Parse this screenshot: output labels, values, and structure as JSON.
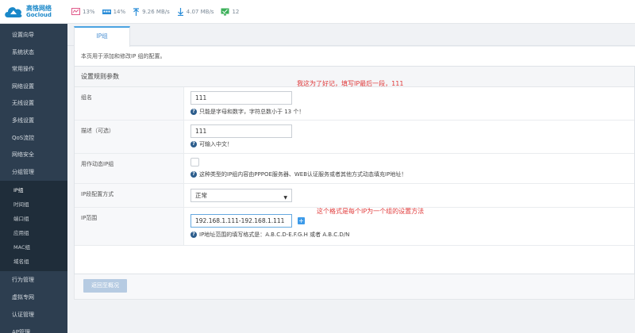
{
  "brand": {
    "name_cn": "高恪网络",
    "name_en": "Gocloud"
  },
  "status": {
    "cpu": "13%",
    "mem": "14%",
    "upload": "9.26 MB/s",
    "download": "4.07 MB/s",
    "connections": "12"
  },
  "menu_top": [
    "设置向导",
    "系统状态",
    "常用操作",
    "网络设置",
    "无线设置",
    "多线设置",
    "QoS流控",
    "网络安全",
    "分组管理"
  ],
  "submenu": [
    "IP组",
    "时间组",
    "端口组",
    "应用组",
    "MAC组",
    "域名组"
  ],
  "menu_bottom": [
    "行为管理",
    "虚拟专网",
    "认证管理",
    "AP管理"
  ],
  "tab": {
    "label": "IP组"
  },
  "description": "本页用于添加和修改IP 组的配置。",
  "panel_title": "设置规则参数",
  "form": {
    "name": {
      "label": "组名",
      "value": "111",
      "hint": "只能是字母和数字，字符总数小于 13 个！"
    },
    "desc": {
      "label": "描述（可选）",
      "value": "111",
      "hint": "可输入中文！"
    },
    "dynamic": {
      "label": "用作动态IP组",
      "hint": "这种类型的IP组内容由PPPOE服务器、WEB认证服务或者其他方式动态填充IP地址！"
    },
    "config_mode": {
      "label": "IP段配置方式",
      "value": "正常"
    },
    "ip_range": {
      "label": "IP范围",
      "value": "192.168.1.111-192.168.1.111",
      "hint": "IP地址范围的填写格式是：A.B.C.D-E.F.G.H 或者 A.B.C.D/N"
    }
  },
  "annotations": {
    "note1": "我这为了好记，填写IP最后一段，111",
    "note2": "这个格式是每个IP为一个组的设置方法"
  },
  "buttons": {
    "back": "返回至概况"
  },
  "colors": {
    "sidebar_bg": "#2d3e50",
    "accent": "#4ba3e1",
    "annotation": "#e03a3a"
  }
}
